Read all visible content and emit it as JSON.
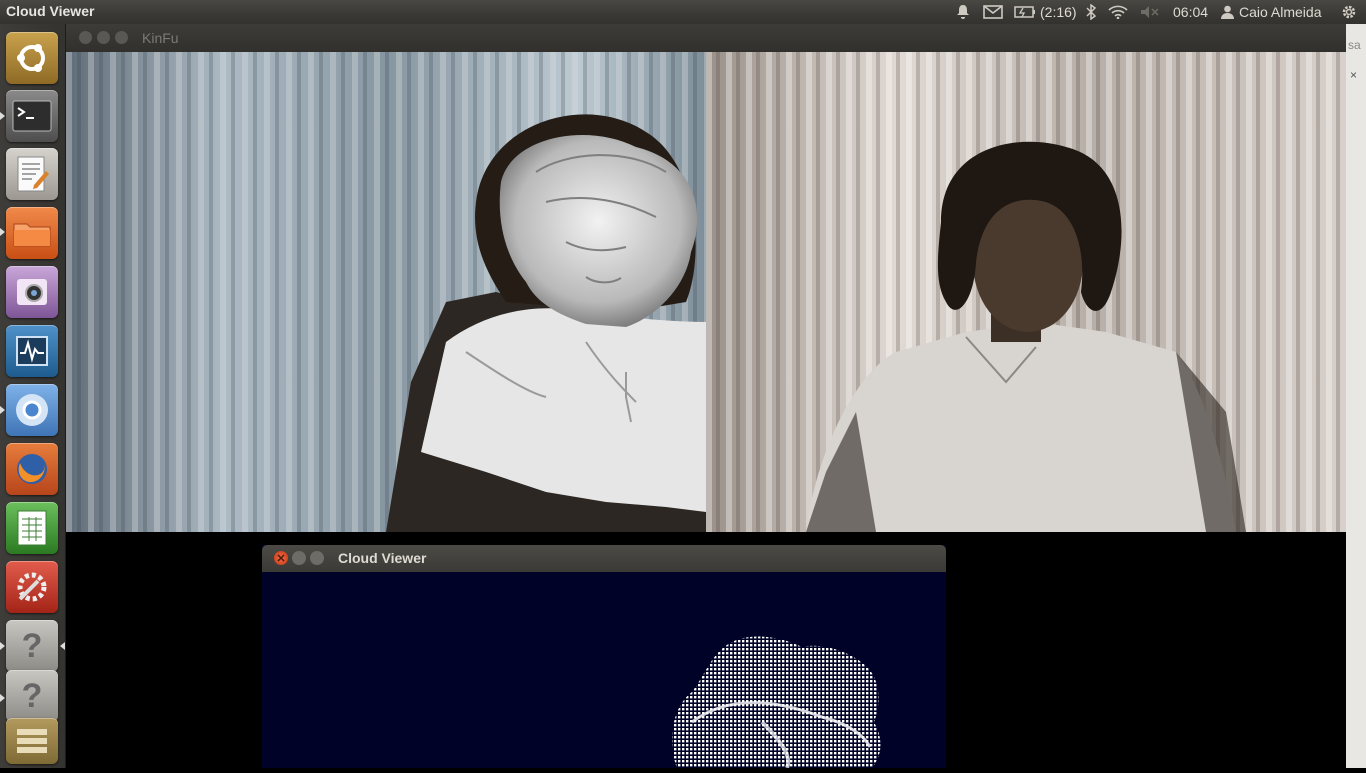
{
  "top_panel": {
    "app_title": "Cloud Viewer",
    "battery_text": "(2:16)",
    "clock": "06:04",
    "user_name": "Caio Almeida"
  },
  "launcher": {
    "items": [
      {
        "name": "Dash home",
        "icon": "ubuntu-logo-icon"
      },
      {
        "name": "Terminal",
        "icon": "terminal-icon"
      },
      {
        "name": "Text Editor",
        "icon": "text-editor-icon"
      },
      {
        "name": "Files",
        "icon": "folder-icon"
      },
      {
        "name": "Cheese",
        "icon": "webcam-icon"
      },
      {
        "name": "System Monitor",
        "icon": "system-monitor-icon"
      },
      {
        "name": "Chromium",
        "icon": "chromium-icon"
      },
      {
        "name": "Firefox",
        "icon": "firefox-icon"
      },
      {
        "name": "Spreadsheet",
        "icon": "spreadsheet-icon"
      },
      {
        "name": "System Settings",
        "icon": "settings-icon"
      },
      {
        "name": "Unknown app",
        "icon": "unknown-app-icon"
      },
      {
        "name": "Unknown app",
        "icon": "unknown-app-icon"
      },
      {
        "name": "Workspace switcher",
        "icon": "workspace-switcher-icon"
      }
    ]
  },
  "kinfu_window": {
    "title": "KinFu",
    "views": [
      "scene-raycast-view",
      "rgb-camera-view"
    ]
  },
  "cloud_viewer": {
    "title": "Cloud Viewer",
    "background": "#000228"
  },
  "right_strip": {
    "partial_text": "sa"
  }
}
